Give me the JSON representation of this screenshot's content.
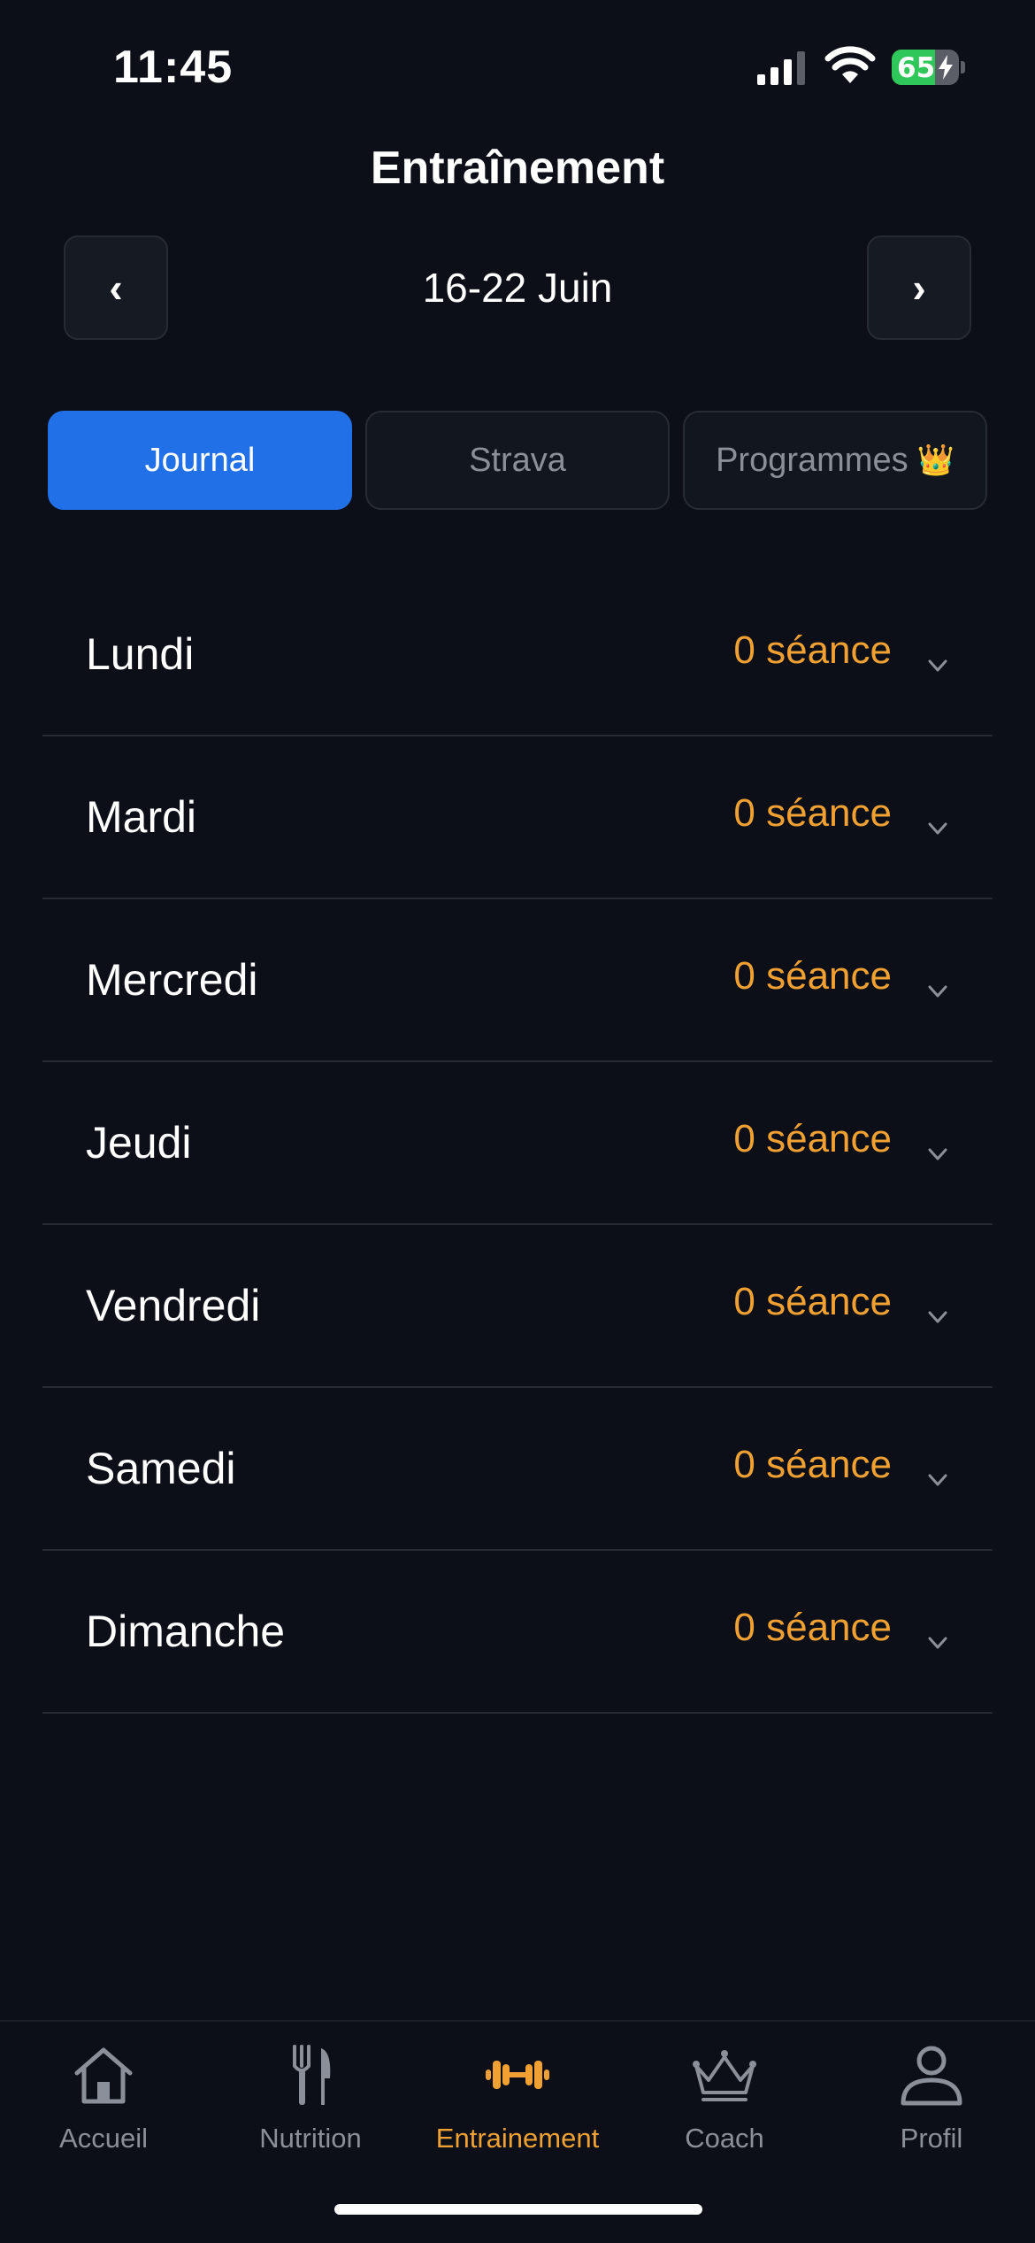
{
  "status_bar": {
    "time": "11:45",
    "battery_level": "65",
    "battery_charging": true,
    "signal_bars_filled": 3,
    "signal_bars_total": 4
  },
  "header": {
    "title": "Entraînement",
    "prev_label": "‹",
    "next_label": "›",
    "week_range": "16-22 Juin"
  },
  "tabs": [
    {
      "label": "Journal",
      "active": true
    },
    {
      "label": "Strava",
      "active": false
    },
    {
      "label": "Programmes",
      "badge": "👑",
      "active": false
    }
  ],
  "days": [
    {
      "name": "Lundi",
      "count": "0 séance"
    },
    {
      "name": "Mardi",
      "count": "0 séance"
    },
    {
      "name": "Mercredi",
      "count": "0 séance"
    },
    {
      "name": "Jeudi",
      "count": "0 séance"
    },
    {
      "name": "Vendredi",
      "count": "0 séance"
    },
    {
      "name": "Samedi",
      "count": "0 séance"
    },
    {
      "name": "Dimanche",
      "count": "0 séance"
    }
  ],
  "bottom_nav": [
    {
      "label": "Accueil",
      "icon": "home-icon",
      "active": false
    },
    {
      "label": "Nutrition",
      "icon": "fork-knife-icon",
      "active": false
    },
    {
      "label": "Entrainement",
      "icon": "dumbbell-icon",
      "active": true
    },
    {
      "label": "Coach",
      "icon": "crown-icon",
      "active": false
    },
    {
      "label": "Profil",
      "icon": "person-icon",
      "active": false
    }
  ],
  "colors": {
    "background": "#0c0f17",
    "accent_blue": "#2170e8",
    "accent_orange": "#f0a132",
    "inactive_gray": "#8a8f99",
    "battery_green": "#30c75a"
  }
}
